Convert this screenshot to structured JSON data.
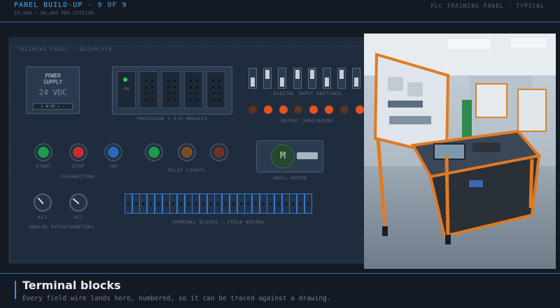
{
  "header": {
    "title": "PANEL BUILD-UP · 9 OF 9",
    "subtitle": "$3,000 – $8,000 PER STATION",
    "right_label": "PLC TRAINING PANEL · TYPICAL"
  },
  "panel": {
    "label": "TRAINING PANEL — BACKPLATE",
    "power_supply": {
      "name": "POWER\nSUPPLY",
      "voltage": "24 VDC",
      "terminals": "L N PE + -"
    },
    "processor": {
      "cpu_label": "CPU",
      "caption": "PROCESSOR + I/O MODULES"
    },
    "digital_inputs": {
      "caption": "DIGITAL INPUT SWITCHES",
      "states": [
        0,
        1,
        0,
        1,
        1,
        0,
        1,
        0
      ]
    },
    "output_indicators": {
      "caption": "OUTPUT INDICATORS",
      "states": [
        0,
        1,
        1,
        0,
        1,
        1,
        0,
        1
      ],
      "on_color": "#e0541e",
      "off_color": "#5a3524"
    },
    "pushbuttons": {
      "caption": "PUSHBUTTONS",
      "items": [
        {
          "label": "START",
          "color": "#1f9a4a"
        },
        {
          "label": "STOP",
          "color": "#c22f2c"
        },
        {
          "label": "JOG",
          "color": "#2a67b8"
        }
      ]
    },
    "pilot_lights": {
      "caption": "PILOT LIGHTS",
      "colors": [
        "#1f9a4a",
        "#7a4d2a",
        "#6b3228"
      ]
    },
    "motor": {
      "symbol": "M",
      "caption": "SMALL MOTOR"
    },
    "potentiometers": {
      "caption": "ANALOG POTENTIOMETERS",
      "items": [
        {
          "label": "AI1"
        },
        {
          "label": "AI2"
        }
      ]
    },
    "terminal_blocks": {
      "caption": "TERMINAL BLOCKS — FIELD WIRING",
      "count": 25
    }
  },
  "caption": {
    "title": "Terminal blocks",
    "text": "Every field wire lands here, numbered, so it can be traced against a drawing."
  }
}
